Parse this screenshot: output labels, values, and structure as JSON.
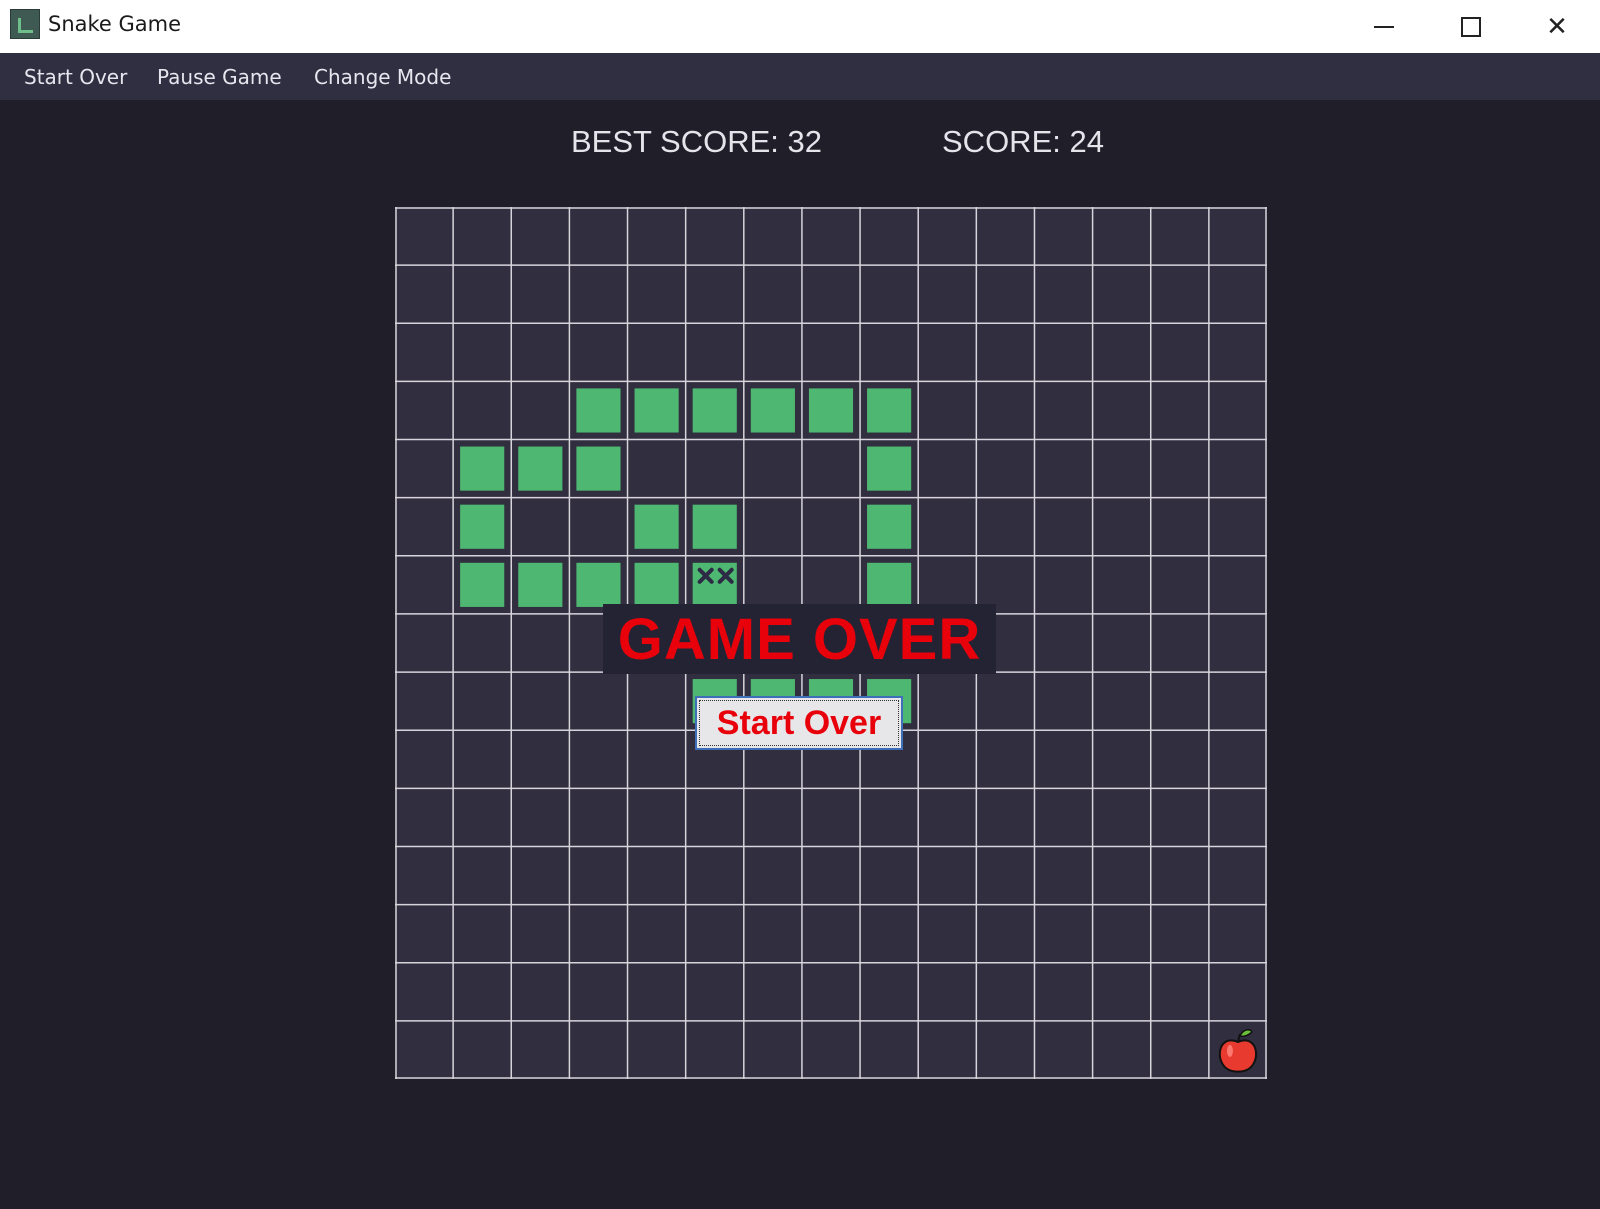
{
  "window": {
    "title": "Snake Game",
    "icon": "snake-app-icon",
    "minimize_icon": "minimize-icon",
    "maximize_icon": "maximize-icon",
    "close_icon": "close-icon",
    "close_glyph": "✕"
  },
  "menu": {
    "items": [
      "Start Over",
      "Pause Game",
      "Change Mode"
    ]
  },
  "scoreboard": {
    "best": "BEST SCORE: 32",
    "current": "SCORE: 24"
  },
  "board": {
    "cols": 15,
    "rows": 15,
    "background": "#312e3f",
    "grid_color": "#d8d4dc",
    "snake_color": "#4eb872",
    "snake_cells": [
      [
        3,
        3
      ],
      [
        4,
        3
      ],
      [
        5,
        3
      ],
      [
        6,
        3
      ],
      [
        7,
        3
      ],
      [
        8,
        3
      ],
      [
        1,
        4
      ],
      [
        2,
        4
      ],
      [
        3,
        4
      ],
      [
        8,
        4
      ],
      [
        1,
        5
      ],
      [
        4,
        5
      ],
      [
        5,
        5
      ],
      [
        8,
        5
      ],
      [
        1,
        6
      ],
      [
        2,
        6
      ],
      [
        3,
        6
      ],
      [
        4,
        6
      ],
      [
        5,
        6
      ],
      [
        8,
        6
      ],
      [
        8,
        7
      ],
      [
        5,
        8
      ],
      [
        6,
        8
      ],
      [
        7,
        8
      ],
      [
        8,
        8
      ]
    ],
    "dead_head_cell": [
      5,
      6
    ],
    "dead_head_icon": "crossed-eyes-icon",
    "apple_cell": [
      14,
      14
    ],
    "apple_icon": "apple-icon"
  },
  "game_over": {
    "banner": "GAME OVER",
    "button_label": "Start Over",
    "text_color": "#e8000b"
  }
}
